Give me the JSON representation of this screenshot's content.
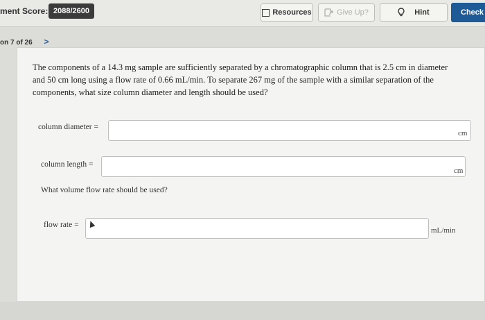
{
  "header": {
    "score_label": "ment Score:",
    "score_value": "2088/2600",
    "resources_label": "Resources",
    "giveup_label": "Give Up?",
    "hint_label": "Hint",
    "check_label": "Check A"
  },
  "nav": {
    "question_position": "on 7 of 26",
    "next_arrow": ">"
  },
  "question": {
    "text": "The components of a 14.3 mg sample are sufficiently separated by a chromatographic column that is 2.5 cm in diameter and 50 cm long using a flow rate of 0.66 mL/min. To separate 267 mg of the sample with a similar separation of the components, what size column diameter and length should be used?",
    "sub_question": "What volume flow rate should be used?"
  },
  "fields": {
    "diameter": {
      "label": "column diameter =",
      "value": "",
      "unit": "cm"
    },
    "length": {
      "label": "column length =",
      "value": "",
      "unit": "cm"
    },
    "flow": {
      "label": "flow rate =",
      "value": "",
      "unit": "mL/min"
    }
  },
  "icons": {
    "resources": "resources-box-icon",
    "giveup": "give-up-icon",
    "hint": "lightbulb-icon",
    "next": "chevron-right-icon",
    "cursor": "mouse-cursor-icon"
  },
  "colors": {
    "accent": "#1e5a96",
    "score_badge": "#3b3b3b"
  }
}
